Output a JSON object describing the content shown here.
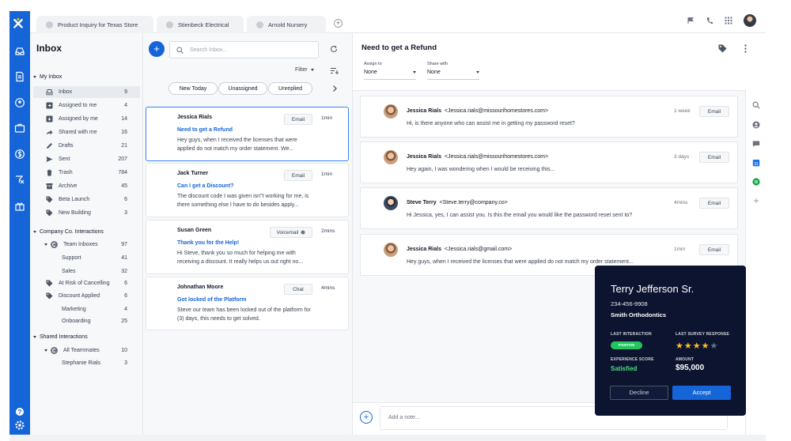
{
  "tabs": [
    {
      "label": "Product Inquiry for Texas Store"
    },
    {
      "label": "Stienbeck Electrical"
    },
    {
      "label": "Arnold Nursery"
    }
  ],
  "sidebar": {
    "title": "Inbox",
    "my_inbox": {
      "label": "My Inbox",
      "items": [
        {
          "label": "Inbox",
          "count": "9",
          "icon": "inbox-icon"
        },
        {
          "label": "Assigned to me",
          "count": "4",
          "icon": "assigned-to-me-icon"
        },
        {
          "label": "Assigned by me",
          "count": "14",
          "icon": "assigned-by-me-icon"
        },
        {
          "label": "Shared with me",
          "count": "16",
          "icon": "share-icon"
        },
        {
          "label": "Drafts",
          "count": "21",
          "icon": "pencil-icon"
        },
        {
          "label": "Sent",
          "count": "207",
          "icon": "send-icon"
        },
        {
          "label": "Trash",
          "count": "784",
          "icon": "trash-icon"
        },
        {
          "label": "Archive",
          "count": "45",
          "icon": "archive-icon"
        },
        {
          "label": "Beta Launch",
          "count": "6",
          "icon": "tag-icon"
        },
        {
          "label": "New Building",
          "count": "3",
          "icon": "tag-icon"
        }
      ]
    },
    "company": {
      "label": "Company Co. Interactions",
      "items": [
        {
          "label": "Team Inboxes",
          "count": "97"
        },
        {
          "label": "Support",
          "count": "41"
        },
        {
          "label": "Sales",
          "count": "32"
        },
        {
          "label": "At Risk of Cancelling",
          "count": "6"
        },
        {
          "label": "Discount Applied",
          "count": "6"
        },
        {
          "label": "Marketing",
          "count": "4"
        },
        {
          "label": "Onboarding",
          "count": "25"
        }
      ]
    },
    "shared": {
      "label": "Shared Interactions",
      "items": [
        {
          "label": "All Teammates",
          "count": "10"
        },
        {
          "label": "Stephanie Rials",
          "count": "3"
        }
      ]
    }
  },
  "list": {
    "search_placeholder": "Search Inbox...",
    "filter_label": "Filter",
    "chips": [
      "New Today",
      "Unassigned",
      "Unreplied"
    ],
    "cards": [
      {
        "name": "Jessica Rials",
        "subject": "Need to get a Refund",
        "body": "Hey guys, when I received the licenses that were applied do not match my order statement. We...",
        "channel": "Email",
        "time": "1min"
      },
      {
        "name": "Jack Turner",
        "subject": "Can I get a Discount?",
        "body": "The discount code I was given isn\"t working for me, is there something else I have to do besides apply...",
        "channel": "Email",
        "time": "1min"
      },
      {
        "name": "Susan Green",
        "subject": "Thank you for the Help!",
        "body": "Hi Steve, thank you so much for helping me with receiving a discount. It really helps us out right no...",
        "channel": "Voicemail",
        "time": "2mins"
      },
      {
        "name": "Johnathan Moore",
        "subject": "Got locked of the Platform",
        "body": "Steve our team has been locked out of the platform for (3) days, this needs to get solved.",
        "channel": "Chat",
        "time": "4mins"
      }
    ]
  },
  "conversation": {
    "title": "Need to get a Refund",
    "assign_to": {
      "label": "Assign to",
      "value": "None"
    },
    "share_with": {
      "label": "Share with",
      "value": "None"
    },
    "messages": [
      {
        "name": "Jessica Rials",
        "email": "<Jessica.rials@missourihomestores.com>",
        "text": "Hi, is there anyone who can assist me in getting my password reset?",
        "time": "1 week",
        "channel": "Email"
      },
      {
        "name": "Jessica Rials",
        "email": "<Jessica.rials@missourihomestores.com>",
        "text": "Hey again, I was wondering when I would be receiving this...",
        "time": "3 days",
        "channel": "Email"
      },
      {
        "name": "Steve Terry",
        "email": "<Steve.terry@company.co>",
        "text": "Hi Jessica, yes, I can assist you.  Is this the email you would like the password reset sent to?",
        "time": "4mins",
        "channel": "Email"
      },
      {
        "name": "Jessica Rials",
        "email": "<Jessica.rials@gmail.com>",
        "text": "Hey guys, when I received the licenses that were applied do not match my order statement...",
        "time": "1min",
        "channel": "Email"
      }
    ],
    "note_placeholder": "Add a note..."
  },
  "popup": {
    "name": "Terry Jefferson Sr.",
    "phone": "234-456-9908",
    "company": "Smith Orthodontics",
    "last_interaction_label": "LAST INTERACTION",
    "last_interaction_value": "POSITIVE",
    "survey_label": "LAST SURVEY RESPONSE",
    "survey_stars": 4,
    "survey_max": 5,
    "experience_label": "EXPERIENCE SCORE",
    "experience_value": "Satisfied",
    "amount_label": "AMOUNT",
    "amount_value": "$95,000",
    "decline_label": "Decline",
    "accept_label": "Accept"
  },
  "colors": {
    "brand": "#1565d8",
    "popup_bg": "#0d1430",
    "positive": "#22c55e",
    "star": "#fbbf24"
  }
}
